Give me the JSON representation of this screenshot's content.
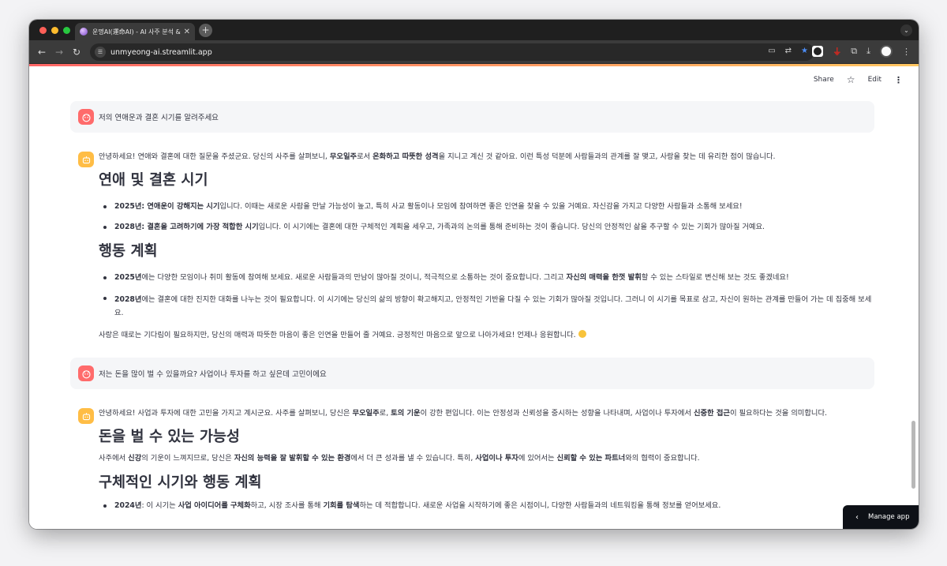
{
  "browser": {
    "tab_title": "운명AI(運命AI) - AI 사주 분석 & ...",
    "tab_close": "✕",
    "new_tab": "+",
    "url": "unmyeong-ai.streamlit.app"
  },
  "header": {
    "share": "Share",
    "edit": "Edit"
  },
  "chat": {
    "q1": "저의 연애운과 결혼 시기를 알려주세요",
    "a1": {
      "intro": [
        "안녕하세요! 연애와 결혼에 대한 질문을 주셨군요. 당신의 사주를 살펴보니, ",
        "무오일주",
        "로서 ",
        "온화하고 따뜻한 성격",
        "을 지니고 계신 것 같아요. 이런 특성 덕분에 사람들과의 관계를 잘 맺고, 사랑을 찾는 데 유리한 점이 많습니다."
      ],
      "h1": "연애 및 결혼 시기",
      "b1": [
        "2025년: 연애운이 강해지는 시기",
        "입니다. 이때는 새로운 사람을 만날 가능성이 높고, 특히 사교 활동이나 모임에 참여하면 좋은 인연을 찾을 수 있을 거예요. 자신감을 가지고 다양한 사람들과 소통해 보세요!"
      ],
      "b2": [
        "2028년: 결혼을 고려하기에 가장 적합한 시기",
        "입니다. 이 시기에는 결혼에 대한 구체적인 계획을 세우고, 가족과의 논의를 통해 준비하는 것이 좋습니다. 당신의 안정적인 삶을 추구할 수 있는 기회가 많아질 거예요."
      ],
      "h2": "행동 계획",
      "b3": [
        "2025년",
        "에는 다양한 모임이나 취미 활동에 참여해 보세요. 새로운 사람들과의 만남이 많아질 것이니, 적극적으로 소통하는 것이 중요합니다. 그리고 ",
        "자신의 매력을 한껏 발휘",
        "할 수 있는 스타일로 변신해 보는 것도 좋겠네요!"
      ],
      "b4": [
        "2028년",
        "에는 결혼에 대한 진지한 대화를 나누는 것이 필요합니다. 이 시기에는 당신의 삶의 방향이 확고해지고, 안정적인 기반을 다질 수 있는 기회가 많아질 것입니다. 그러니 이 시기를 목표로 삼고, 자신이 원하는 관계를 만들어 가는 데 집중해 보세요."
      ],
      "outro": "사랑은 때로는 기다림이 필요하지만, 당신의 매력과 따뜻한 마음이 좋은 인연을 만들어 줄 거예요. 긍정적인 마음으로 앞으로 나아가세요! 언제나 응원합니다."
    },
    "q2": "저는 돈을 많이 벌 수 있을까요? 사업이나 투자를 하고 싶은데 고민이에요",
    "a2": {
      "intro": [
        "안녕하세요! 사업과 투자에 대한 고민을 가지고 계시군요. 사주를 살펴보니, 당신은 ",
        "무오일주",
        "로, ",
        "토의 기운",
        "이 강한 편입니다. 이는 안정성과 신뢰성을 중시하는 성향을 나타내며, 사업이나 투자에서 ",
        "신중한 접근",
        "이 필요하다는 것을 의미합니다."
      ],
      "h1": "돈을 벌 수 있는 가능성",
      "p1": [
        "사주에서 ",
        "신강",
        "의 기운이 느껴지므로, 당신은 ",
        "자신의 능력을 잘 발휘할 수 있는 환경",
        "에서 더 큰 성과를 낼 수 있습니다. 특히, ",
        "사업이나 투자",
        "에 있어서는 ",
        "신뢰할 수 있는 파트너",
        "와의 협력이 중요합니다."
      ],
      "h2": "구체적인 시기와 행동 계획",
      "b1": [
        "2024년",
        ": 이 시기는 ",
        "사업 아이디어를 구체화",
        "하고, 시장 조사를 통해 ",
        "기회를 탐색",
        "하는 데 적합합니다. 새로운 사업을 시작하기에 좋은 시점이니, 다양한 사람들과의 네트워킹을 통해 정보를 얻어보세요."
      ]
    }
  },
  "manage_app": "Manage app"
}
